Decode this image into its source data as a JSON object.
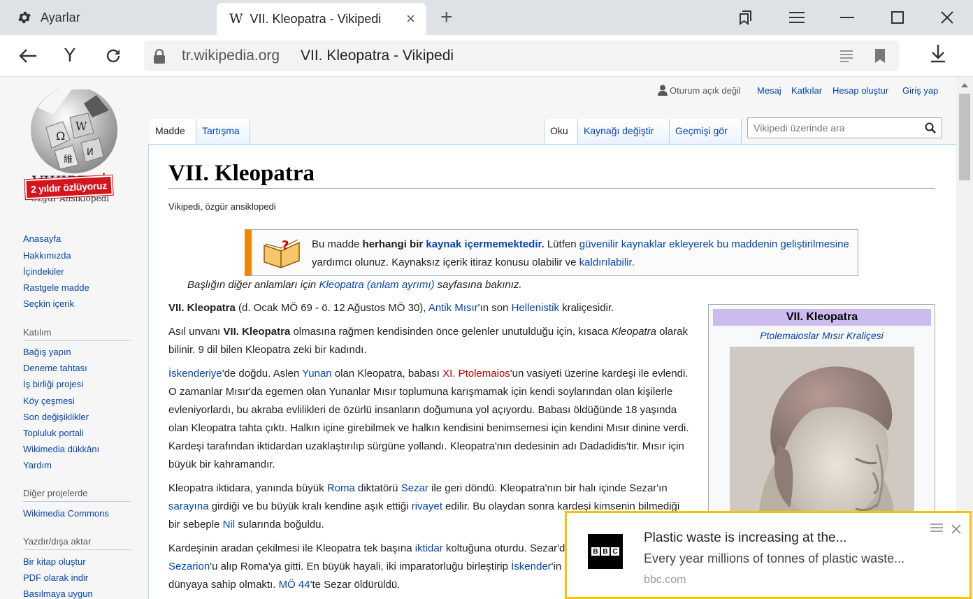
{
  "browser": {
    "settings_tab_label": "Ayarlar",
    "active_tab_title": "VII. Kleopatra - Vikipedi",
    "active_tab_favicon": "W",
    "new_tab_glyph": "+",
    "close_tab_glyph": "×",
    "nav_up_glyph": "Y",
    "address_domain": "tr.wikipedia.org",
    "address_page_title": "VII. Kleopatra - Vikipedi"
  },
  "sidebar": {
    "banner": "2 yıldır özlüyoruz",
    "nav": [
      "Anasayfa",
      "Hakkımızda",
      "İçindekiler",
      "Rastgele madde",
      "Seçkin içerik"
    ],
    "participation_heading": "Katılım",
    "participation": [
      "Bağış yapın",
      "Deneme tahtası",
      "İş birliği projesi",
      "Köy çeşmesi",
      "Son değişiklikler",
      "Topluluk portali",
      "Wikimedia dükkânı",
      "Yardım"
    ],
    "other_heading": "Diğer projelerde",
    "other": [
      "Wikimedia Commons"
    ],
    "print_heading": "Yazdır/dışa aktar",
    "print": [
      "Bir kitap oluştur",
      "PDF olarak indir",
      "Basılmaya uygun"
    ]
  },
  "personal": {
    "not_logged_in": "Oturum açık değil",
    "talk": "Mesaj",
    "contribs": "Katkılar",
    "create_account": "Hesap oluştur",
    "login": "Giriş yap"
  },
  "tabs": {
    "article": "Madde",
    "talk": "Tartışma",
    "read": "Oku",
    "edit_source": "Kaynağı değiştir",
    "history": "Geçmişi gör"
  },
  "search": {
    "placeholder": "Vikipedi üzerinde ara"
  },
  "article": {
    "title": "VII. Kleopatra",
    "tagline": "Vikipedi, özgür ansiklopedi",
    "ambox": {
      "t1": "Bu madde ",
      "t2": "herhangi bir ",
      "t3": "kaynak içermemektedir.",
      "t4": " Lütfen ",
      "t5": "güvenilir kaynaklar ekleyerek",
      "t6": " ",
      "t7": "bu maddenin geliştirilmesine",
      "t8": " yardımcı olunuz. Kaynaksız içerik itiraz konusu olabilir ve ",
      "t9": "kaldırılabilir",
      "t10": "."
    },
    "hatnote": {
      "before": "Başlığın diğer anlamları için ",
      "link": "Kleopatra (anlam ayrımı)",
      "after": " sayfasına bakınız."
    },
    "p1": {
      "a": "VII. Kleopatra",
      "b": " (d. Ocak MÖ 69 - ö. 12 Ağustos MÖ 30), ",
      "c": "Antik Mısır",
      "d": "'ın son ",
      "e": "Hellenistik",
      "f": " kraliçesidir."
    },
    "p2": {
      "a": "Asıl unvanı ",
      "b": "VII. Kleopatra",
      "c": " olmasına rağmen kendisinden önce gelenler unutulduğu için, kısaca ",
      "d": "Kleopatra",
      "e": " olarak bilinir. 9 dil bilen Kleopatra zeki bir kadındı."
    },
    "p3": {
      "a": "İskenderiye",
      "b": "'de doğdu. Aslen ",
      "c": "Yunan",
      "d": " olan Kleopatra, babası ",
      "e": "XI. Ptolemaios",
      "f": "'un vasiyeti üzerine kardeşi ile evlendi. O zamanlar Mısır'da egemen olan Yunanlar Mısır toplumuna karışmamak için kendi soylarından olan kişilerle evleniyorlardı, bu akraba evlilikleri de özürlü insanların doğumuna yol açıyordu. Babası öldüğünde 18 yaşında olan Kleopatra tahta çıktı. Halkın içine girebilmek ve halkın kendisini benimsemesi için kendini Mısır dinine verdi. Kardeşi tarafından iktidardan uzaklaştırılıp sürgüne yollandı. Kleopatra'nın dedesinin adı Dadadidis'tir. Mısır için büyük bir kahramandır."
    },
    "p4": {
      "a": "Kleopatra iktidara, yanında büyük ",
      "b": "Roma",
      "c": " diktatörü ",
      "d": "Sezar",
      "e": " ile geri döndü. Kleopatra'nın bir halı içinde Sezar'ın ",
      "f": "sarayına",
      "g": " girdiği ve bu büyük kralı kendine aşık ettiği ",
      "h": "rivayet",
      "i": " edilir. Bu olaydan sonra kardeşi kimsenin bilmediği bir sebeple ",
      "j": "Nil",
      "k": " sularında boğuldu."
    },
    "p5": {
      "a": "Kardeşinin aradan çekilmesi ile Kleopatra tek başına ",
      "b": "iktidar",
      "c": " koltuğuna oturdu. Sezar'dan bir çocuğu oldu ve minik ",
      "d": "Sezarion",
      "e": "'u alıp Roma'ya gitti. En büyük hayali, iki imparatorluğu birleştirip ",
      "f": "İskender",
      "g": "'in de hayali olarak bilinen tüm dünyaya sahip olmaktı. ",
      "h": "MÖ 44",
      "i": "'te Sezar öldürüldü."
    }
  },
  "infobox": {
    "title": "VII. Kleopatra",
    "subtitle": "Ptolemaioslar Mısır Kraliçesi"
  },
  "notification": {
    "source_logo": "BBC",
    "title": "Plastic waste is increasing at the...",
    "text": "Every year millions of tonnes of plastic waste...",
    "source": "bbc.com"
  },
  "colors": {
    "link": "#0645ad",
    "redlink": "#ba0000",
    "infobox_header": "#ccbbee",
    "ambox_border": "#f28500",
    "notification_border": "#f5c400"
  }
}
